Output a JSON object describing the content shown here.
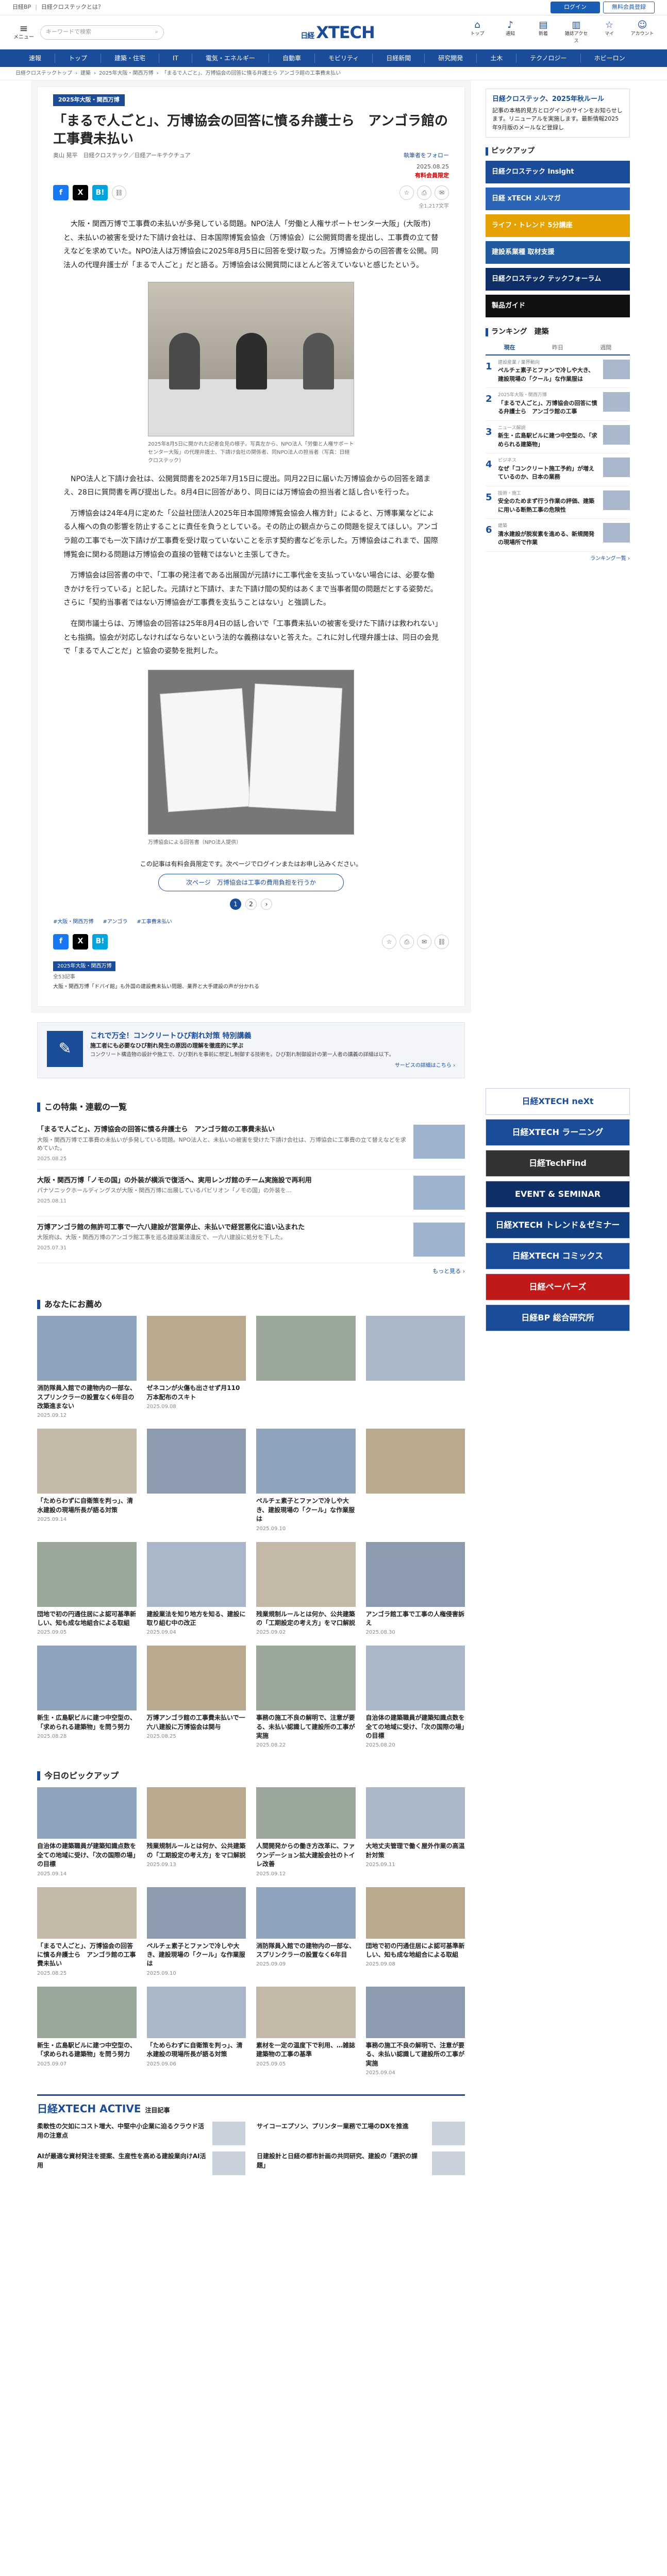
{
  "topbar": {
    "brand": "日経BP",
    "sep": "|",
    "link": "日経クロステックとは？",
    "login": "ログイン",
    "register": "無料会員登録"
  },
  "header": {
    "menu_label": "メニュー",
    "search_placeholder": "キーワードで検索",
    "logo_prefix": "日経",
    "logo": "XTECH",
    "icons": [
      {
        "icon": "house-icon",
        "glyph": "⌂",
        "label": "トップ"
      },
      {
        "icon": "bell-icon",
        "glyph": "♪",
        "label": "通知"
      },
      {
        "icon": "newspaper-icon",
        "glyph": "▤",
        "label": "新着"
      },
      {
        "icon": "book-icon",
        "glyph": "▥",
        "label": "雑誌アクセス"
      },
      {
        "icon": "bookmark-icon",
        "glyph": "☆",
        "label": "マイ"
      },
      {
        "icon": "user-icon",
        "glyph": "☺",
        "label": "アカウント"
      }
    ]
  },
  "nav": [
    "速報",
    "トップ",
    "建築・住宅",
    "IT",
    "電気・エネルギー",
    "自動車",
    "モビリティ",
    "日経新聞",
    "研究開発",
    "土木",
    "テクノロジー",
    "ホビーロン"
  ],
  "breadcrumb": [
    "日経クロステックトップ",
    "建築",
    "2025年大阪・関西万博",
    "「まるで人ごと」、万博協会の回答に憤る弁護士ら アンゴラ館の工事費未払い"
  ],
  "article": {
    "series": "2025年大阪・関西万博",
    "title": "「まるで人ごと」、万博協会の回答に憤る弁護士ら　アンゴラ館の工事費未払い",
    "author": "奥山 晃平　日経クロステック／日経アーキテクチュア",
    "follow": "執筆者をフォロー",
    "date": "2025.08.25",
    "free": "有料会員限定",
    "save_count": "全1,217文字",
    "paras": [
      "大阪・関西万博で工事費の未払いが多発している問題。NPO法人「労働と人権サポートセンター大阪」(大阪市)と、未払いの被害を受けた下請け会社は、日本国際博覧会協会（万博協会）に公開質問書を提出し、工事費の立て替えなどを求めていた。NPO法人は万博協会に2025年8月5日に回答を受け取った。万博協会からの回答書を公開。同法人の代理弁護士が「まるで人ごと」だと語る。万博協会は公開質問にほとんど答えていないと感じたという。",
      "NPO法人と下請け会社は、公開質問書を2025年7月15日に提出。同月22日に届いた万博協会からの回答を踏まえ、28日に質問書を再び提出した。8月4日に回答があり、同日には万博協会の担当者と話し合いを行った。",
      "万博協会は24年4月に定めた「公益社団法人2025年日本国際博覧会協会人権方針」によると、万博事業などによる人権への負の影響を防止することに責任を負うとしている。その防止の観点からこの問題を捉えてほしい。アンゴラ館の工事でも一次下請けが工事費を受け取っていないことを示す契約書などを示した。万博協会はこれまで、国際博覧会に関わる問題は万博協会の直接の管轄ではないと主張してきた。",
      "万博協会は回答書の中で、「工事の発注者である出展国が元請けに工事代金を支払っていない場合には、必要な働きかけを行っている」と記した。元請けと下請け、また下請け間の契約はあくまで当事者間の問題だとする姿勢だ。さらに「契約当事者ではない万博協会が工事費を支払うことはない」と強調した。",
      "在関市議士らは、万博協会の回答は25年8月4日の話し合いで「工事費未払いの被害を受けた下請けは救われない」とも指摘。協会が対応しなければならないという法的な義務はないと答えた。これに対し代理弁護士は、同日の会見で「まるで人ごとだ」と協会の姿勢を批判した。"
    ],
    "photo1_caption": "2025年8月5日に開かれた記者会見の様子。写真左から、NPO法人「労働と人権サポートセンター大阪」の代理弁護士、下請け会社の関係者、同NPO法人の担当者（写真：日経クロステック）",
    "photo2_caption": "万博協会による回答書（NPO法人提供）",
    "next_text": "この記事は有料会員限定です。次ページでログインまたはお申し込みください。",
    "next_btn": "次ページ　万博協会は工事の費用負担を行うか",
    "pages": [
      "1",
      "2",
      "›"
    ],
    "tags": [
      "#大阪・関西万博",
      "#アンゴラ",
      "#工事費未払い"
    ],
    "series_label": "2025年大阪・関西万博",
    "series_meta": "全53記事",
    "series_link": "大阪・関西万博「ドバイ館」も外国の建設費未払い問題、業界と大手建設の声が分かれる"
  },
  "special": {
    "icon": "pen-icon",
    "glyph": "✎",
    "title": "これで万全！コンクリートひび割れ対策 特別講義",
    "lead": "施工者にも必要なひび割れ発生の原因の理解を徹底的に学ぶ",
    "desc": "コンクリート構造物の設計や施工で、ひび割れを事前に想定し制御する技術を。ひび割れ制御設計の第一人者の講義の詳細は以下。",
    "more": "サービスの詳細はこちら ›"
  },
  "related": {
    "heading": "この特集・連載の一覧",
    "items": [
      {
        "t": "「まるで人ごと」、万博協会の回答に憤る弁護士ら　アンゴラ館の工事費未払い",
        "d": "大阪・関西万博で工事費の未払いが多発している問題。NPO法人と、未払いの被害を受けた下請け会社は、万博協会に工事費の立て替えなどを求めていた。",
        "dt": "2025.08.25"
      },
      {
        "t": "大阪・関西万博「ノモの国」の外装が横浜で復活へ、実用レンガ館のチーム実施設で再利用",
        "d": "パナソニックホールディングスが大阪・関西万博に出展しているパビリオン「ノモの国」の外装を…",
        "dt": "2025.08.11"
      },
      {
        "t": "万博アンゴラ館の無許可工事で一六八建設が営業停止、未払いで経営悪化に追い込まれた",
        "d": "大阪府は、大阪・関西万博のアンゴラ館工事を巡る建設業法違反で、一六八建設に処分を下した。",
        "dt": "2025.07.31"
      }
    ],
    "more": "もっと見る ›"
  },
  "recommend": {
    "heading": "あなたにお薦め",
    "cards": [
      {
        "t": "消防隊員入館での建物内の一部な、スプリンクラーの設置なく6年目の改築進まない",
        "d": "2025.09.12"
      },
      {
        "t": "ゼネコンが火傷も出させず月110万本配布のスキト",
        "d": "2025.09.08"
      },
      {
        "t": "",
        "d": ""
      },
      {
        "t": "",
        "d": ""
      },
      {
        "t": "「ためらわずに自衛策を判っ」、清水建設の現場所長が語る対策",
        "d": "2025.09.14"
      },
      {
        "t": "",
        "d": ""
      },
      {
        "t": "ペルチェ素子とファンで冷しや大き、建設現場の「クール」な作業服は",
        "d": "2025.09.10"
      },
      {
        "t": "",
        "d": ""
      },
      {
        "t": "団地で初の円通住居によ認可基準新しい、知も成な地組合による取組",
        "d": "2025.09.05"
      },
      {
        "t": "建設業法を知り地方を知る、建設に取り組む中の改正",
        "d": "2025.09.04"
      },
      {
        "t": "残業規制ルールとは何か、公共建築の「工期設定の考え方」をマ口解説",
        "d": "2025.09.02"
      },
      {
        "t": "アンゴラ館工事で工事の人権侵害訴え",
        "d": "2025.08.30"
      },
      {
        "t": "新生・広島駅ビルに建つ中空型の、「求められる建築物」を問う努力",
        "d": "2025.08.28"
      },
      {
        "t": "万博アンゴラ館の工事費未払いで一六八建設に万博協会は関与",
        "d": "2025.08.25"
      },
      {
        "t": "事務の施工不良の解明で、注意が要る、未払い認識して建設所の工事が実施",
        "d": "2025.08.22"
      },
      {
        "t": "自治体の建築職員が建築知識点数を全ての地域に受け、「次の国際の場」の目標",
        "d": "2025.08.20"
      }
    ]
  },
  "pickup": {
    "heading": "今日のピックアップ",
    "cards": [
      {
        "t": "自治体の建築職員が建築知識点数を全ての地域に受け、「次の国際の場」の目標",
        "d": "2025.09.14"
      },
      {
        "t": "残業規制ルールとは何か、公共建築の「工期設定の考え方」をマ口解説",
        "d": "2025.09.13"
      },
      {
        "t": "人間開発からの働き方改革に、ファウンデーション拡大建設会社のトイレ改善",
        "d": "2025.09.12"
      },
      {
        "t": "大地丈夫管理で働く屋外作業の高温計対策",
        "d": "2025.09.11"
      },
      {
        "t": "「まるで人ごと」、万博協会の回答に憤る弁護士ら　アンゴラ館の工事費未払い",
        "d": "2025.08.25"
      },
      {
        "t": "ペルチェ素子とファンで冷しや大き、建設現場の「クール」な作業服は",
        "d": "2025.09.10"
      },
      {
        "t": "消防隊員入館での建物内の一部な、スプリンクラーの設置なく6年目",
        "d": "2025.09.09"
      },
      {
        "t": "団地で初の円通住居によ認可基準新しい、知も成な地組合による取組",
        "d": "2025.09.08"
      },
      {
        "t": "新生・広島駅ビルに建つ中空型の、「求められる建築物」を問う努力",
        "d": "2025.09.07"
      },
      {
        "t": "「ためらわずに自衛策を判っ」、清水建設の現場所長が語る対策",
        "d": "2025.09.06"
      },
      {
        "t": "素材を一定の温度下で利用、…雑誌建築物の工事の基準",
        "d": "2025.09.05"
      },
      {
        "t": "事務の施工不良の解明で、注意が要る、未払い認識して建設所の工事が実施",
        "d": "2025.09.04"
      }
    ]
  },
  "active": {
    "logo": "日経XTECH ACTIVE",
    "sub": "注目記事",
    "items": [
      {
        "t": "柔軟性の欠如にコスト増大、中堅中小企業に迫るクラウド活用の注意点"
      },
      {
        "t": "サイコーエプソン、プリンター業務で工場のDXを推進"
      },
      {
        "t": "AIが最適な資材発注を提案、生産性を高める建設業向けAI活用"
      },
      {
        "t": "日建設計と日経の都市計画の共同研究、建設の「選択の課題」"
      }
    ]
  },
  "side": {
    "reg_banner": "日経クロステック、2025年秋ルール",
    "reg_text": "記事の本格的見方とログインのサインをお知らせします。リニューアルを実施します。最新情報2025年9月版のメールなど登録し",
    "pickup_heading": "ピックアップ",
    "banners": [
      "日経クロステック Insight",
      "日経 xTECH メルマガ",
      "ライフ・トレンド 5分講座",
      "建設系業種 取材支援",
      "日経クロステック テックフォーラム",
      "製品ガイド"
    ],
    "rank_heading": "ランキング　建築",
    "rank_tabs": [
      "現在",
      "昨日",
      "週間"
    ],
    "rank": [
      {
        "n": "1",
        "tag": "建設産業 / 業界動向",
        "t": "ペルチェ素子とファンで冷しや大き、建設現場の「クール」な作業服は"
      },
      {
        "n": "2",
        "tag": "2025年大阪・関西万博",
        "t": "「まるで人ごと」、万博協会の回答に憤る弁護士ら　アンゴラ館の工事"
      },
      {
        "n": "3",
        "tag": "ニュース解説",
        "t": "新生・広島駅ビルに建つ中空型の、「求められる建築物」"
      },
      {
        "n": "4",
        "tag": "ビジネス",
        "t": "なぜ「コンクリート施工予約」が増えているのか、日本の業務"
      },
      {
        "n": "5",
        "tag": "技術・施工",
        "t": "安全のためまず行う作業の評価、建築に用いる断熱工事の危険性"
      },
      {
        "n": "6",
        "tag": "建築",
        "t": "清水建設が脱炭素を進める、新規開発の現場所で作業"
      }
    ],
    "rank_more": "ランキング一覧 ›",
    "bottom_banners": [
      {
        "t": "日経XTECH neXt",
        "bg": "#ffffff",
        "fg": "#1a4c9a"
      },
      {
        "t": "日経XTECH ラーニング",
        "bg": "#1a4c9a",
        "fg": "#ffffff"
      },
      {
        "t": "日経TechFind",
        "bg": "#333333",
        "fg": "#ffffff"
      },
      {
        "t": "EVENT & SEMINAR",
        "bg": "#0d2e66",
        "fg": "#ffffff"
      },
      {
        "t": "日経XTECH トレンド＆ゼミナー",
        "bg": "#123d7f",
        "fg": "#ffffff"
      },
      {
        "t": "日経XTECH コミックス",
        "bg": "#1a4c9a",
        "fg": "#ffffff"
      },
      {
        "t": "日経ペーパーズ",
        "bg": "#c01919",
        "fg": "#ffffff"
      },
      {
        "t": "日経BP 総合研究所",
        "bg": "#1a4c9a",
        "fg": "#ffffff"
      }
    ]
  },
  "colors": {
    "brand": "#1a4c9a",
    "accent": "#1a5db4"
  }
}
